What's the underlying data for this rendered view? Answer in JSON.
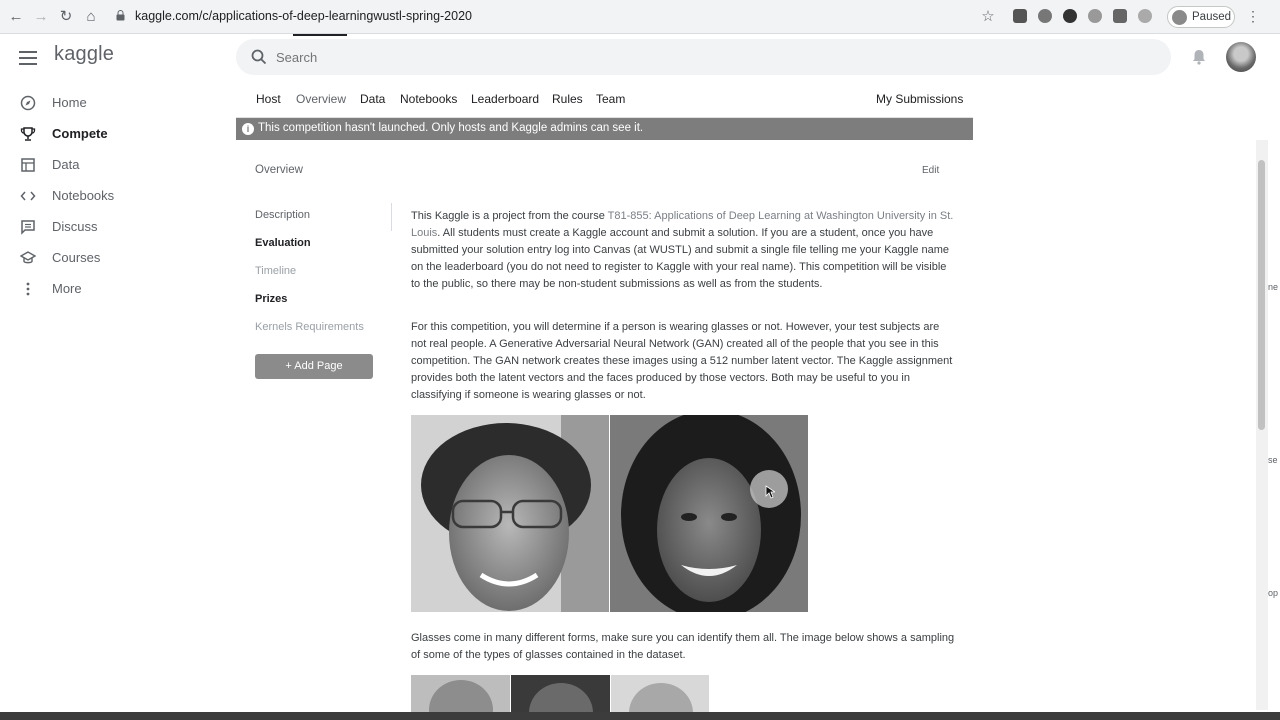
{
  "browser": {
    "url": "kaggle.com/c/applications-of-deep-learningwustl-spring-2020",
    "profile_label": "Paused"
  },
  "header": {
    "logo": "kaggle",
    "search_placeholder": "Search"
  },
  "sidebar": {
    "items": [
      {
        "label": "Home",
        "icon": "home-compass-icon"
      },
      {
        "label": "Compete",
        "icon": "trophy-icon"
      },
      {
        "label": "Data",
        "icon": "table-icon"
      },
      {
        "label": "Notebooks",
        "icon": "code-icon"
      },
      {
        "label": "Discuss",
        "icon": "chat-icon"
      },
      {
        "label": "Courses",
        "icon": "graduation-cap-icon"
      },
      {
        "label": "More",
        "icon": "more-vertical-icon"
      }
    ]
  },
  "tabs": {
    "items": [
      "Host",
      "Overview",
      "Data",
      "Notebooks",
      "Leaderboard",
      "Rules",
      "Team"
    ],
    "right": "My Submissions"
  },
  "banner": {
    "text": "This competition hasn't launched. Only hosts and Kaggle admins can see it."
  },
  "overview": {
    "heading": "Overview",
    "edit": "Edit",
    "nav": [
      "Description",
      "Evaluation",
      "Timeline",
      "Prizes",
      "Kernels Requirements"
    ],
    "add_page": "Add Page"
  },
  "content": {
    "p1_before": "This Kaggle is a project from the course ",
    "p1_link": "T81-855: Applications of Deep Learning at Washington University in St. Louis",
    "p1_after": ". All students must create a Kaggle account and submit a solution. If you are a student, once you have submitted your solution entry log into Canvas (at WUSTL) and submit a single file telling me your Kaggle name on the leaderboard (you do not need to register to Kaggle with your real name). This competition will be visible to the public, so there may be non-student submissions as well as from the students.",
    "p2": "For this competition, you will determine if a person is wearing glasses or not. However, your test subjects are not real people. A Generative Adversarial Neural Network (GAN) created all of the people that you see in this competition. The GAN network creates these images using a 512 number latent vector. The Kaggle assignment provides both the latent vectors and the faces produced by those vectors. Both may be useful to you in classifying if someone is wearing glasses or not.",
    "p3": "Glasses come in many different forms, make sure you can identify them all. The image below shows a sampling of some of the types of glasses contained in the dataset."
  },
  "edge": {
    "frag1": "ne",
    "frag2": "se",
    "frag3": "op"
  }
}
